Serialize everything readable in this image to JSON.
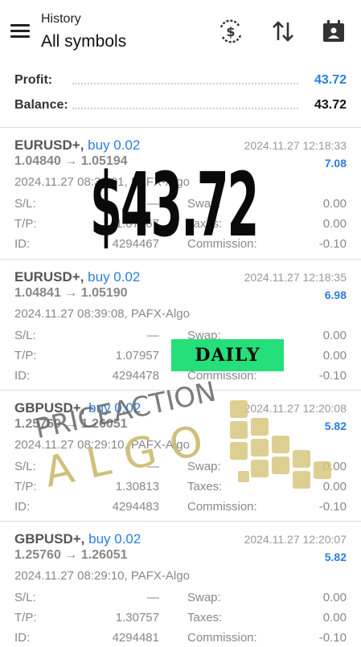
{
  "header": {
    "subtitle": "History",
    "title": "All symbols",
    "icons": [
      "menu-icon",
      "currency-exchange-icon",
      "sort-icon",
      "calendar-person-icon"
    ]
  },
  "summary": {
    "profit_label": "Profit:",
    "profit_value": "43.72",
    "balance_label": "Balance:",
    "balance_value": "43.72"
  },
  "trades": [
    {
      "symbol": "EURUSD+,",
      "direction": "buy 0.02",
      "close_time": "2024.11.27 12:18:33",
      "prices": "1.04840 → 1.05194",
      "profit": "7.08",
      "open_info": "2024.11.27 08:39:01, PAFX-Algo",
      "sl_label": "S/L:",
      "sl_value": "—",
      "swap_label": "Swap:",
      "swap_value": "0.00",
      "tp_label": "T/P:",
      "tp_value": "1.07967",
      "taxes_label": "Taxes:",
      "taxes_value": "0.00",
      "id_label": "ID:",
      "id_value": "4294467",
      "commission_label": "Commission:",
      "commission_value": "-0.10"
    },
    {
      "symbol": "EURUSD+,",
      "direction": "buy 0.02",
      "close_time": "2024.11.27 12:18:35",
      "prices": "1.04841 → 1.05190",
      "profit": "6.98",
      "open_info": "2024.11.27 08:39:08, PAFX-Algo",
      "sl_label": "S/L:",
      "sl_value": "—",
      "swap_label": "Swap:",
      "swap_value": "0.00",
      "tp_label": "T/P:",
      "tp_value": "1.07957",
      "taxes_label": "Taxes:",
      "taxes_value": "0.00",
      "id_label": "ID:",
      "id_value": "4294478",
      "commission_label": "Commission:",
      "commission_value": "-0.10"
    },
    {
      "symbol": "GBPUSD+,",
      "direction": "buy 0.02",
      "close_time": "2024.11.27 12:20:08",
      "prices": "1.25760 → 1.26051",
      "profit": "5.82",
      "open_info": "2024.11.27 08:29:10, PAFX-Algo",
      "sl_label": "S/L:",
      "sl_value": "—",
      "swap_label": "Swap:",
      "swap_value": "0.00",
      "tp_label": "T/P:",
      "tp_value": "1.30813",
      "taxes_label": "Taxes:",
      "taxes_value": "0.00",
      "id_label": "ID:",
      "id_value": "4294483",
      "commission_label": "Commission:",
      "commission_value": "-0.10"
    },
    {
      "symbol": "GBPUSD+,",
      "direction": "buy 0.02",
      "close_time": "2024.11.27 12:20:07",
      "prices": "1.25760 → 1.26051",
      "profit": "5.82",
      "open_info": "2024.11.27 08:29:10, PAFX-Algo",
      "sl_label": "S/L:",
      "sl_value": "—",
      "swap_label": "Swap:",
      "swap_value": "0.00",
      "tp_label": "T/P:",
      "tp_value": "1.30757",
      "taxes_label": "Taxes:",
      "taxes_value": "0.00",
      "id_label": "ID:",
      "id_value": "4294481",
      "commission_label": "Commission:",
      "commission_value": "-0.10"
    }
  ],
  "overlay": {
    "big_amount": "$43.72",
    "daily_badge": "DAILY",
    "brand_line1": "PRICEACTION",
    "brand_line2": "ALGO"
  },
  "colors": {
    "accent_blue": "#2a7de1",
    "daily_green": "#25e07a",
    "brand_gold": "#cdb970"
  }
}
